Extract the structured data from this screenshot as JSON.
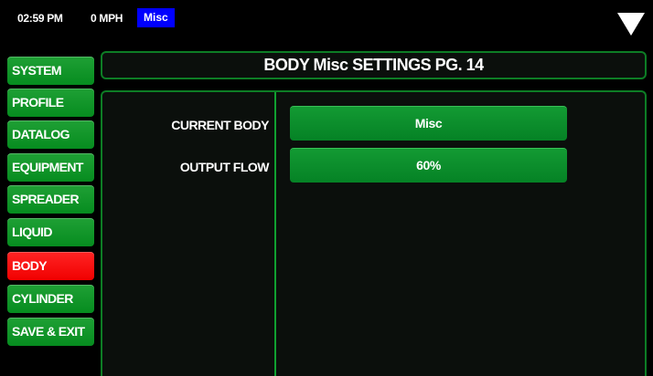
{
  "status_bar": {
    "time": "02:59 PM",
    "speed": "0 MPH",
    "body_name": "Misc",
    "body_badge_color": "#0000ff",
    "menu_icon": "triangle-down-icon"
  },
  "sidebar": {
    "items": [
      {
        "label": "SYSTEM",
        "active": false
      },
      {
        "label": "PROFILE",
        "active": false
      },
      {
        "label": "DATALOG",
        "active": false
      },
      {
        "label": "EQUIPMENT",
        "active": false
      },
      {
        "label": "SPREADER",
        "active": false
      },
      {
        "label": "LIQUID",
        "active": false
      },
      {
        "label": "BODY",
        "active": true
      },
      {
        "label": "CYLINDER",
        "active": false
      },
      {
        "label": "SAVE & EXIT",
        "active": false
      }
    ],
    "colors": {
      "default": "#0a931f",
      "active": "#ff1010"
    }
  },
  "page": {
    "title": "BODY Misc SETTINGS PG. 14"
  },
  "settings": [
    {
      "label": "CURRENT BODY",
      "value": "Misc"
    },
    {
      "label": "OUTPUT FLOW",
      "value": "60%"
    }
  ],
  "theme": {
    "background": "#000000",
    "accent_green": "#0d7d25",
    "button_green": "#0a8f2a"
  }
}
